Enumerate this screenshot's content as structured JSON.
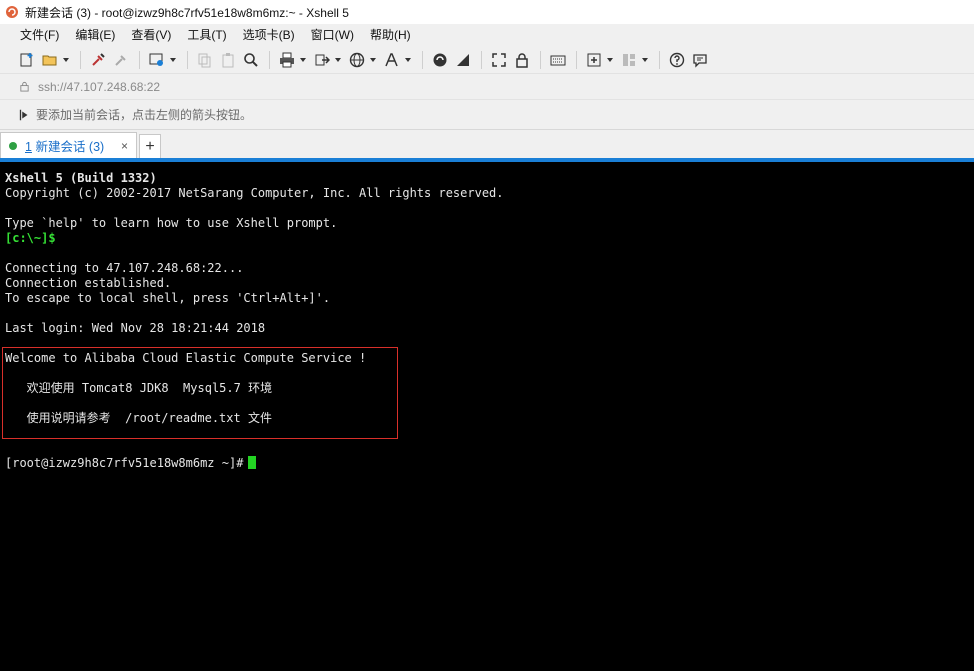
{
  "window": {
    "title": "新建会话 (3) - root@izwz9h8c7rfv51e18w8m6mz:~ - Xshell 5"
  },
  "menu": {
    "items": [
      {
        "label": "文件(F)"
      },
      {
        "label": "编辑(E)"
      },
      {
        "label": "查看(V)"
      },
      {
        "label": "工具(T)"
      },
      {
        "label": "选项卡(B)"
      },
      {
        "label": "窗口(W)"
      },
      {
        "label": "帮助(H)"
      }
    ]
  },
  "address": {
    "value": "ssh://47.107.248.68:22"
  },
  "hint": {
    "text": "要添加当前会话，点击左侧的箭头按钮。"
  },
  "tabs": [
    {
      "number": "1",
      "label": "新建会话 (3)",
      "close": "×"
    }
  ],
  "tab_add": "+",
  "colors": {
    "accent": "#1a7fd6",
    "prompt_green": "#35e035",
    "motd_border": "#d9302a",
    "cursor": "#23d423"
  },
  "terminal": {
    "lines": [
      "Xshell 5 (Build 1332)",
      "Copyright (c) 2002-2017 NetSarang Computer, Inc. All rights reserved.",
      "",
      "Type `help' to learn how to use Xshell prompt.",
      "[c:\\~]$",
      "",
      "Connecting to 47.107.248.68:22...",
      "Connection established.",
      "To escape to local shell, press 'Ctrl+Alt+]'.",
      "",
      "Last login: Wed Nov 28 18:21:44 2018",
      "",
      "Welcome to Alibaba Cloud Elastic Compute Service !",
      "",
      "   欢迎使用 Tomcat8 JDK8  Mysql5.7 环境",
      "",
      "   使用说明请参考  /root/readme.txt 文件",
      "",
      "",
      "[root@izwz9h8c7rfv51e18w8m6mz ~]#"
    ]
  }
}
